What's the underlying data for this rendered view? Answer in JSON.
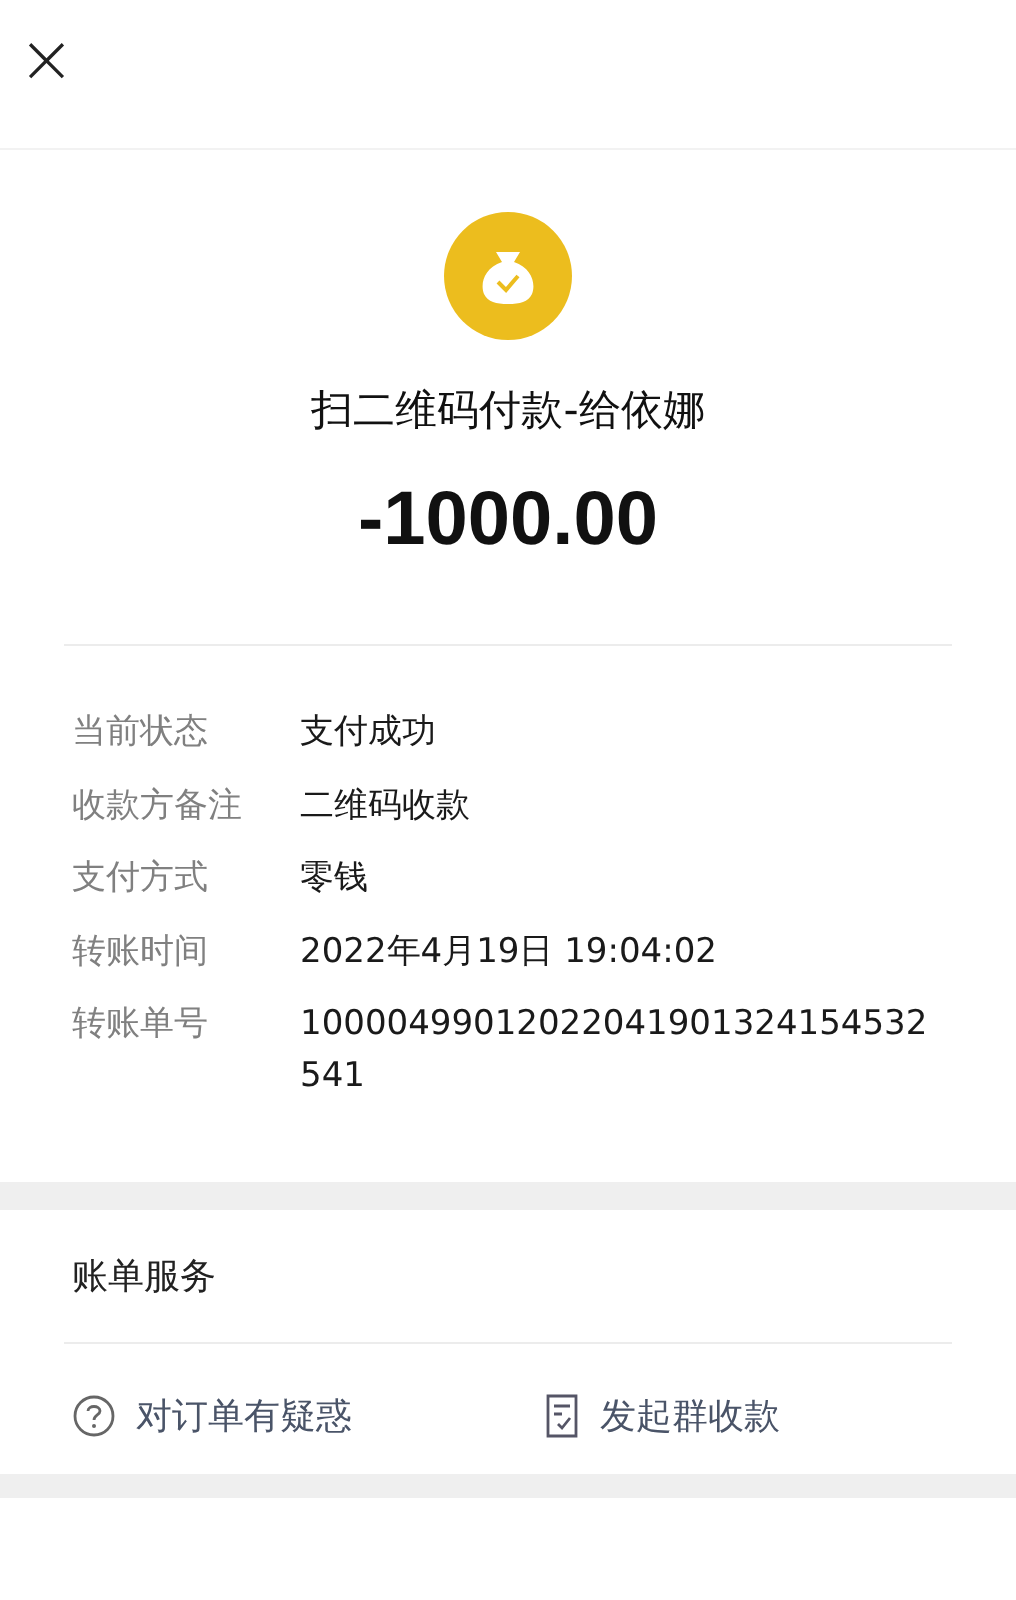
{
  "header": {
    "close": "×"
  },
  "summary": {
    "title": "扫二维码付款-给依娜",
    "amount": "-1000.00"
  },
  "details": [
    {
      "label": "当前状态",
      "value": "支付成功"
    },
    {
      "label": "收款方备注",
      "value": "二维码收款"
    },
    {
      "label": "支付方式",
      "value": "零钱"
    },
    {
      "label": "转账时间",
      "value": "2022年4月19日 19:04:02"
    },
    {
      "label": "转账单号",
      "value": "10000499012022041901324154532541"
    }
  ],
  "services": {
    "title": "账单服务",
    "actions": [
      {
        "kind": "question",
        "label": "对订单有疑惑"
      },
      {
        "kind": "group",
        "label": "发起群收款"
      }
    ]
  }
}
